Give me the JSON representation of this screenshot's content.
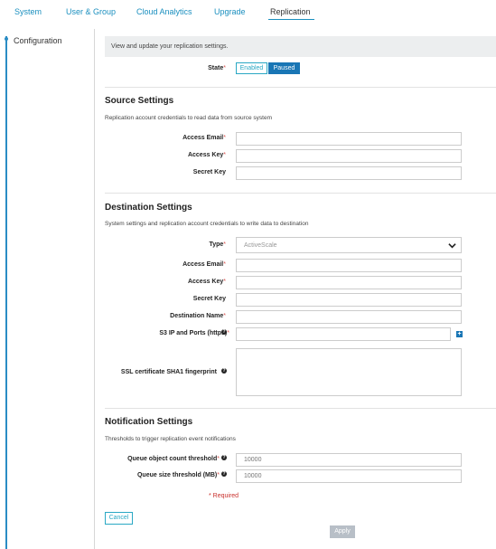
{
  "nav": {
    "tabs": [
      {
        "label": "System"
      },
      {
        "label": "User & Group"
      },
      {
        "label": "Cloud Analytics"
      },
      {
        "label": "Upgrade"
      },
      {
        "label": "Replication"
      }
    ],
    "active": "Replication"
  },
  "sidebar": {
    "items": [
      {
        "label": "Configuration"
      }
    ]
  },
  "info": "View and update your replication settings.",
  "state": {
    "label": "State",
    "required_mark": "*",
    "enabled_label": "Enabled",
    "paused_label": "Paused",
    "selected": "Paused"
  },
  "source": {
    "title": "Source Settings",
    "description": "Replication account credentials to read data from source system",
    "access_email_label": "Access Email",
    "access_key_label": "Access Key",
    "secret_key_label": "Secret Key",
    "required_mark": "*"
  },
  "destination": {
    "title": "Destination Settings",
    "description": "System settings and replication account credentials to write data to destination",
    "type_label": "Type",
    "type_value": "ActiveScale",
    "access_email_label": "Access Email",
    "access_key_label": "Access Key",
    "secret_key_label": "Secret Key",
    "destination_name_label": "Destination Name",
    "s3_label": "S3 IP and Ports (https)",
    "ssl_label": "SSL certificate SHA1 fingerprint",
    "required_mark": "*",
    "help_glyph": "?",
    "add_glyph": "+"
  },
  "notification": {
    "title": "Notification Settings",
    "description": "Thresholds to trigger replication event notifications",
    "object_count_label": "Queue object count threshold",
    "object_count_placeholder": "10000",
    "queue_size_label": "Queue size threshold (MB)",
    "queue_size_placeholder": "10000",
    "required_mark": "*"
  },
  "footer": {
    "required_note": "* Required",
    "cancel_label": "Cancel",
    "apply_label": "Apply"
  },
  "colors": {
    "accent": "#1a8fbf",
    "primary": "#1976b5",
    "required": "#d9534f",
    "disabled_button": "#b8bfc7"
  }
}
